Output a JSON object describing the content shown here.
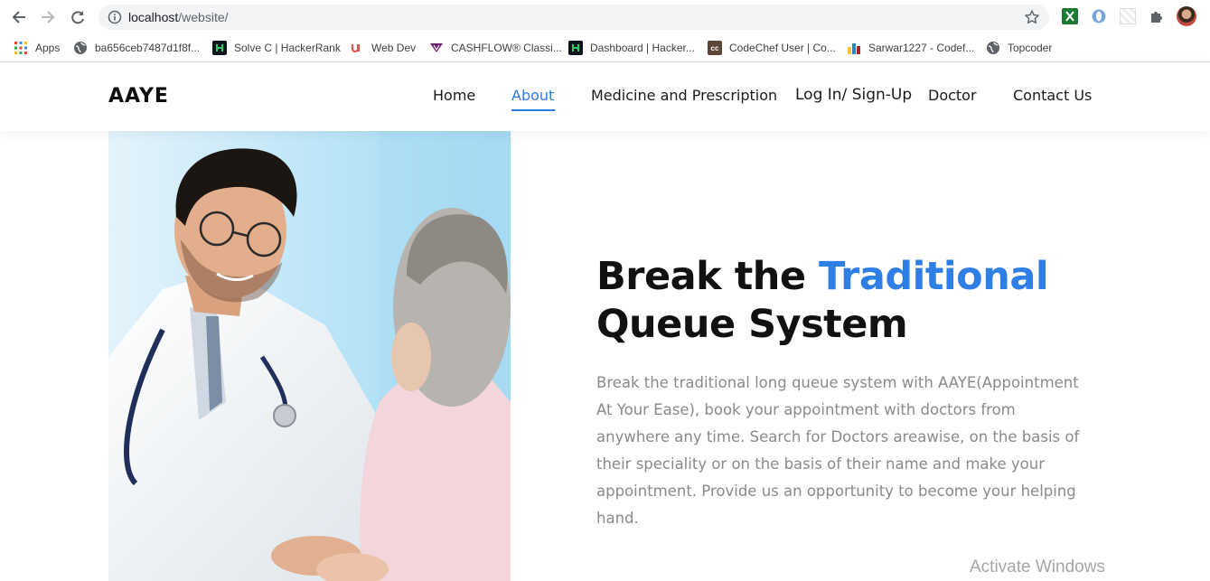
{
  "browser": {
    "url_host": "localhost",
    "url_path": "/website/",
    "bookmarks": [
      {
        "label": "Apps",
        "icon": "apps-grid-icon"
      },
      {
        "label": "ba656ceb7487d1f8f...",
        "icon": "globe-icon"
      },
      {
        "label": "Solve C | HackerRank",
        "icon": "hackerrank-icon"
      },
      {
        "label": "Web Dev",
        "icon": "udemy-icon"
      },
      {
        "label": "CASHFLOW® Classi...",
        "icon": "cashflow-icon"
      },
      {
        "label": "Dashboard | Hacker...",
        "icon": "hackerrank-icon"
      },
      {
        "label": "CodeChef User | Co...",
        "icon": "codechef-icon"
      },
      {
        "label": "Sarwar1227 - Codef...",
        "icon": "codeforces-icon"
      },
      {
        "label": "Topcoder",
        "icon": "globe-icon"
      }
    ]
  },
  "site": {
    "logo": "AAYE",
    "nav": {
      "home": "Home",
      "about": "About",
      "medicine": "Medicine and Prescription",
      "login": "Log In/ Sign-Up",
      "doctor": "Doctor",
      "contact": "Contact Us"
    },
    "active_nav": "About",
    "accent_color": "#2f7ee6"
  },
  "hero": {
    "headline_part1": "Break the ",
    "headline_accent": "Traditional",
    "headline_line2": "Queue System",
    "description": "Break the traditional long queue system with AAYE(Appointment At Your Ease), book your appointment with doctors from anywhere any time. Search for Doctors areawise, on the basis of their speciality or on the basis of their name and make your appointment. Provide us an opportunity to become your helping hand."
  },
  "watermark": "Activate Windows"
}
